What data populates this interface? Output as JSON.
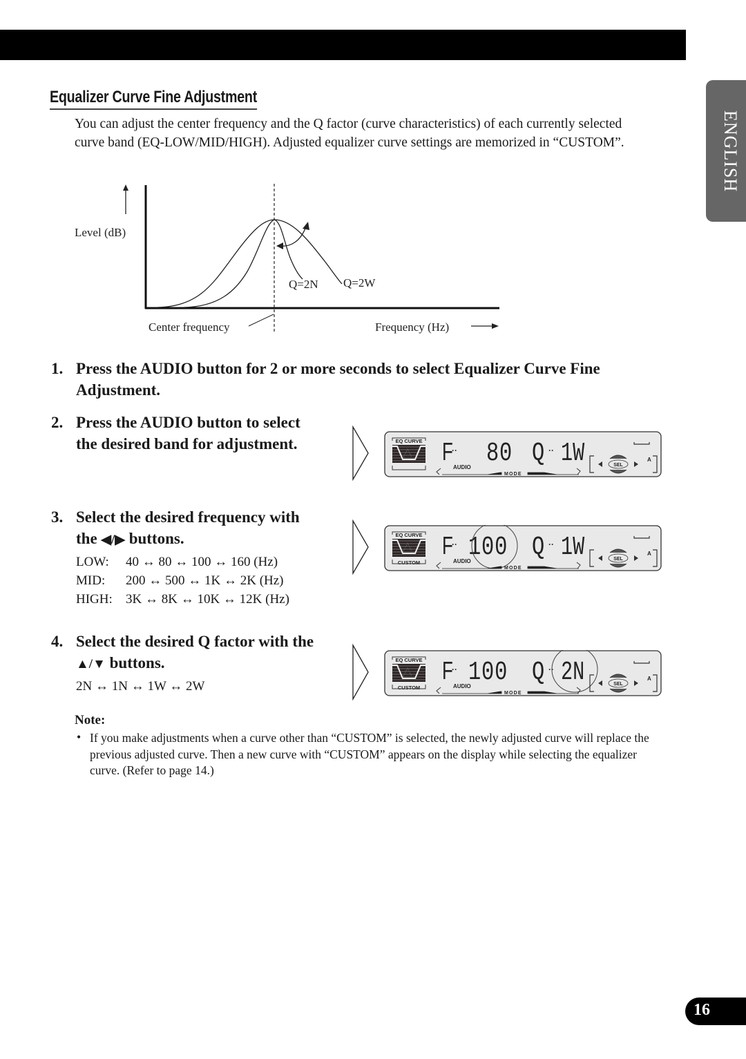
{
  "tab": {
    "language": "ENGLISH"
  },
  "section": {
    "title": "Equalizer Curve Fine Adjustment",
    "intro": "You can adjust the center frequency and the Q factor (curve characteristics) of each currently selected curve band (EQ-LOW/MID/HIGH). Adjusted equalizer curve settings are memorized in “CUSTOM”."
  },
  "diagram": {
    "ylabel": "Level (dB)",
    "xlabel": "Frequency (Hz)",
    "center_label": "Center frequency",
    "curve_labels": [
      "Q=2N",
      "Q=2W"
    ]
  },
  "steps": [
    {
      "num": "1.",
      "text": "Press the AUDIO button for 2 or more seconds to select Equalizer Curve Fine Adjustment."
    },
    {
      "num": "2.",
      "text": "Press the AUDIO button to select the desired band for adjustment."
    },
    {
      "num": "3.",
      "text_before": "Select the desired frequency with the ",
      "glyph": "◀/▶",
      "text_after": " buttons."
    },
    {
      "num": "4.",
      "text_before": "Select the desired Q factor with the ",
      "glyph": "▲/▼",
      "text_after": " buttons."
    }
  ],
  "frequency_bands": [
    {
      "label": "LOW:",
      "values": "40 ↔ 80 ↔ 100 ↔ 160 (Hz)"
    },
    {
      "label": "MID:",
      "values": "200 ↔ 500 ↔ 1K ↔ 2K (Hz)"
    },
    {
      "label": "HIGH:",
      "values": "3K ↔ 8K ↔ 10K ↔ 12K (Hz)"
    }
  ],
  "q_factors": "2N ↔ 1N ↔ 1W ↔ 2W",
  "displays": [
    {
      "eq_label": "EQ CURVE",
      "custom_label": "",
      "freq": "80",
      "q": "1W",
      "audio": "AUDIO",
      "mode": "MODE",
      "sel": "SEL",
      "a": "A",
      "highlight": ""
    },
    {
      "eq_label": "EQ CURVE",
      "custom_label": "CUSTOM",
      "freq": "100",
      "q": "1W",
      "audio": "AUDIO",
      "mode": "MODE",
      "sel": "SEL",
      "a": "A",
      "highlight": "freq"
    },
    {
      "eq_label": "EQ CURVE",
      "custom_label": "CUSTOM",
      "freq": "100",
      "q": "2N",
      "audio": "AUDIO",
      "mode": "MODE",
      "sel": "SEL",
      "a": "A",
      "highlight": "q"
    }
  ],
  "note": {
    "title": "Note:",
    "bullet": "•",
    "text": "If you make adjustments when a curve other than “CUSTOM” is selected, the newly adjusted curve will replace the previous adjusted curve. Then a new curve with “CUSTOM” appears on the display while selecting the equalizer curve. (Refer to page 14.)"
  },
  "page_number": "16"
}
